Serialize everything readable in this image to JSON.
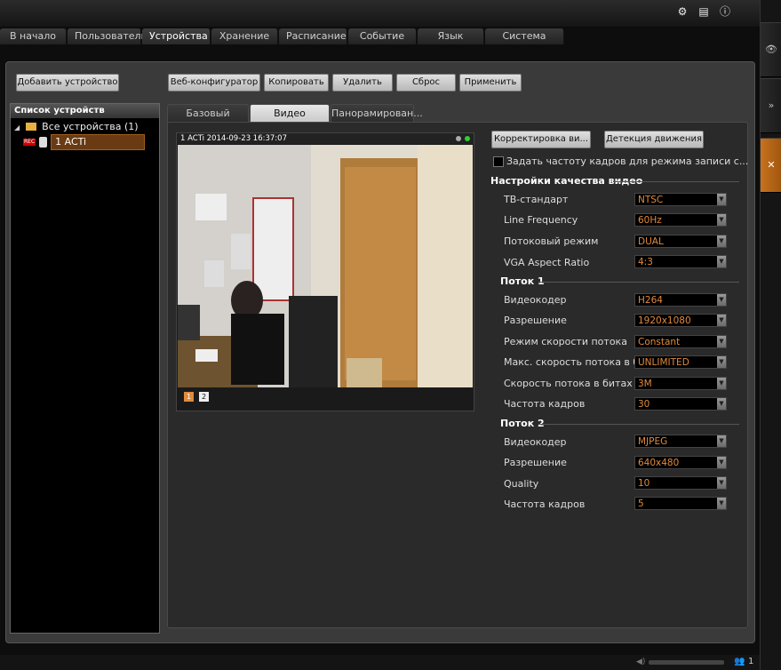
{
  "tabs": [
    "В начало",
    "Пользователи",
    "Устройства",
    "Хранение",
    "Расписание",
    "Событие",
    "Язык",
    "Система"
  ],
  "active_tab": "Устройства",
  "toolbar": {
    "add_device": "Добавить устройство",
    "web_config": "Веб-конфигуратор",
    "copy": "Копировать",
    "delete": "Удалить",
    "reset": "Сброс",
    "apply": "Применить"
  },
  "device_list": {
    "title": "Список устройств",
    "root": "Все устройства (1)",
    "device": "1 ACTi",
    "rec_badge": "REC"
  },
  "subtabs": [
    "Базовый",
    "Видео",
    "Панорамирован..."
  ],
  "active_subtab": "Видео",
  "video": {
    "overlay": "1 ACTi  2014-09-23 16:37:07",
    "stream_buttons": [
      "1",
      "2"
    ]
  },
  "actions": {
    "correction": "Корректировка ви...",
    "motion": "Детекция движения",
    "checkbox_label": "Задать частоту кадров для режима записи с..."
  },
  "quality": {
    "title": "Настройки качества видео",
    "rows": [
      {
        "label": "ТВ-стандарт",
        "value": "NTSC"
      },
      {
        "label": "Line Frequency",
        "value": "60Hz"
      },
      {
        "label": "Потоковый режим",
        "value": "DUAL"
      },
      {
        "label": "VGA Aspect Ratio",
        "value": "4:3"
      }
    ]
  },
  "stream1": {
    "title": "Поток 1",
    "rows": [
      {
        "label": "Видеокодер",
        "value": "H264"
      },
      {
        "label": "Разрешение",
        "value": "1920x1080"
      },
      {
        "label": "Режим скорости потока",
        "value": "Constant"
      },
      {
        "label": "Макс. скорость потока в би...",
        "value": "UNLIMITED"
      },
      {
        "label": "Скорость потока в битах",
        "value": "3M"
      },
      {
        "label": "Частота кадров",
        "value": "30"
      }
    ]
  },
  "stream2": {
    "title": "Поток 2",
    "rows": [
      {
        "label": "Видеокодер",
        "value": "MJPEG"
      },
      {
        "label": "Разрешение",
        "value": "640x480"
      },
      {
        "label": "Quality",
        "value": "10"
      },
      {
        "label": "Частота кадров",
        "value": "5"
      }
    ]
  },
  "status": {
    "users": "1"
  },
  "colors": {
    "accent": "#e08a3c",
    "side_active": "#c8731e"
  }
}
